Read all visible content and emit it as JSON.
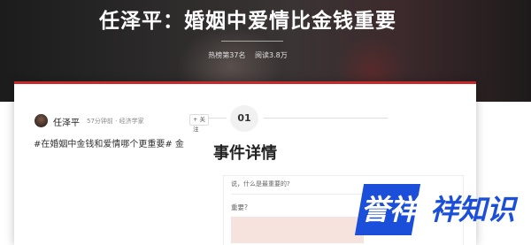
{
  "hero": {
    "title": "任泽平：婚姻中爱情比金钱重要",
    "hot_rank": "热榜第37名",
    "reads": "阅读3.8万"
  },
  "section": {
    "number": "01",
    "title": "事件详情"
  },
  "post": {
    "author": "任泽平",
    "meta": "57分钟前 · 经济学家",
    "follow_label": "+ 关注",
    "hashtag_text": "#在婚姻中金钱和爱情哪个更重要# 金"
  },
  "reply_panel": {
    "question_line": "说，什么是最重要的?",
    "question_line2": "重要?"
  },
  "watermark": {
    "logo_box_text": "誉祥",
    "logo_text": "祥知识"
  }
}
